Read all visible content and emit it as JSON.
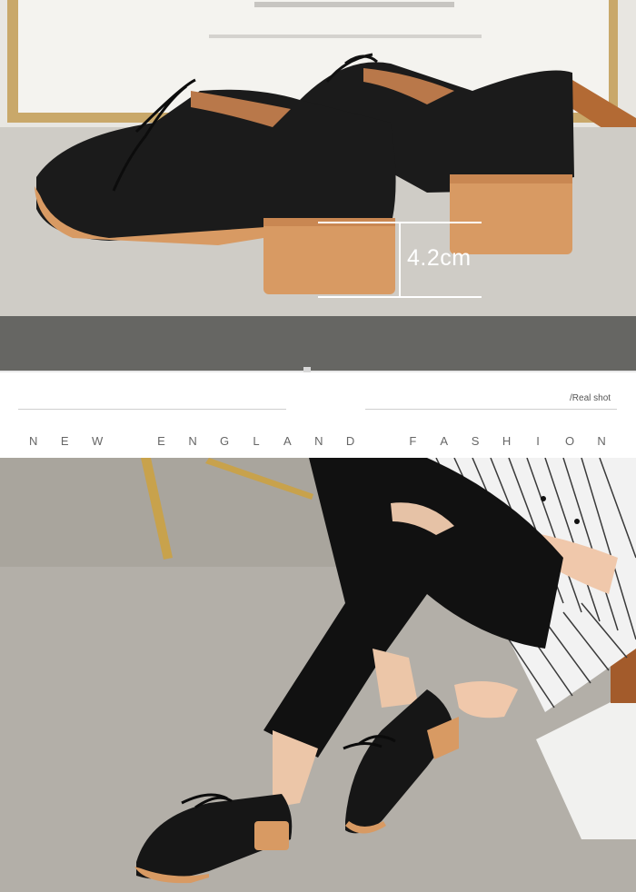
{
  "top_photo": {
    "heel_height_label": "4.2cm"
  },
  "header": {
    "real_shot_label": "Real shot",
    "tagline_letters": [
      "N",
      "E",
      "W",
      "",
      "E",
      "N",
      "G",
      "L",
      "A",
      "N",
      "D",
      "",
      "F",
      "A",
      "S",
      "H",
      "I",
      "O",
      "N"
    ]
  },
  "colors": {
    "background": "#ffffff",
    "grey_band": "#666663",
    "divider_line": "#cfcfcf",
    "tagline_text": "#666666",
    "shoe_leather": "#1b1b1b",
    "heel_wood": "#d89a63"
  }
}
